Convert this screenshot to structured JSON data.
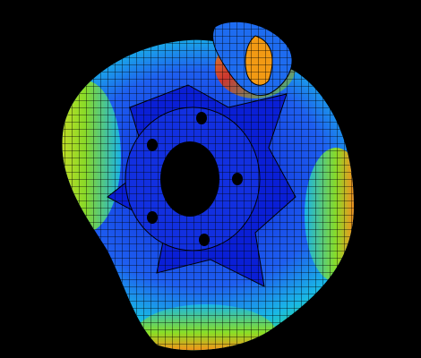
{
  "scene": {
    "subject": "finite-element-mesh-wheel-rim",
    "background_color": "#000000",
    "mesh_line_color": "#000000",
    "bolt_hole_count": 5,
    "colormap": [
      "#0a1fd6",
      "#1e6cf0",
      "#19b8e6",
      "#2ed88a",
      "#8ee01e",
      "#e8e21a",
      "#f29a14",
      "#e0321a"
    ],
    "icons": [
      "bolt-hole-icon",
      "center-bore-icon"
    ]
  }
}
